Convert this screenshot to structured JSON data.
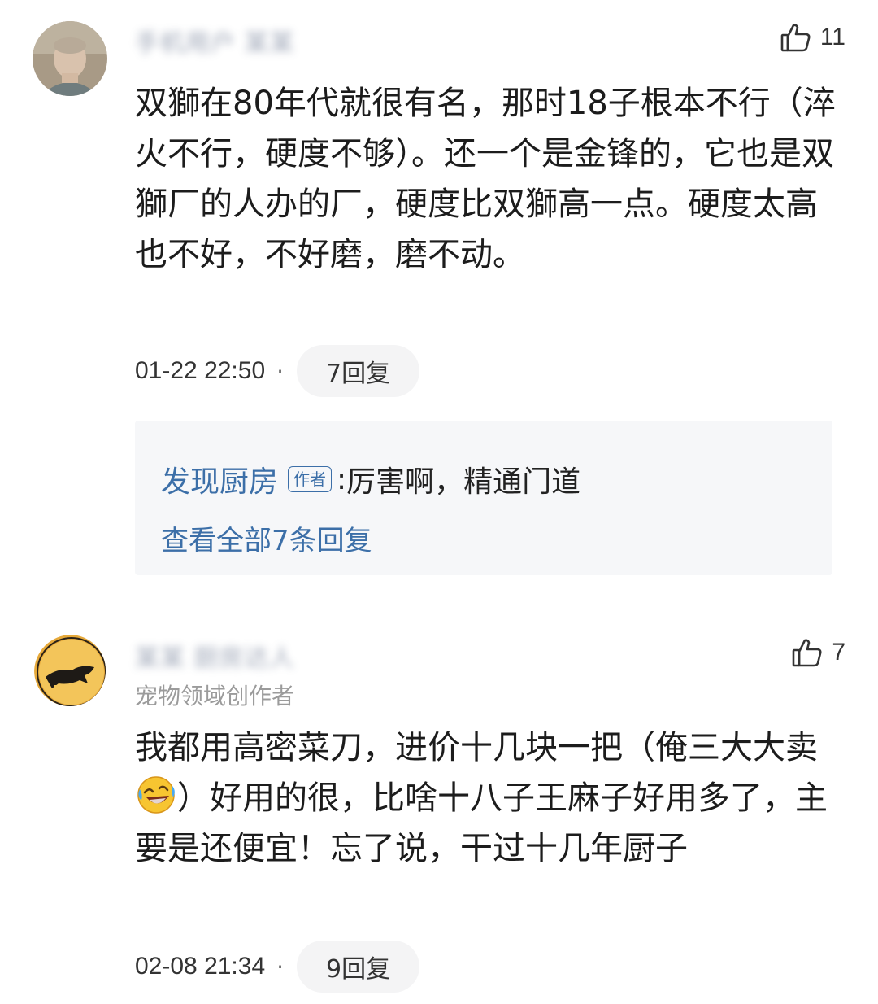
{
  "comments": [
    {
      "username": "手机用户 某某",
      "likes": "11",
      "body": "双獅在80年代就很有名，那时18子根本不行（淬火不行，硬度不够）。还一个是金锋的，它也是双獅厂的人办的厂，硬度比双獅高一点。硬度太高也不好，不好磨，磨不动。",
      "time": "01-22 22:50",
      "replies_label": "7回复",
      "reply_preview": {
        "author": "发现厨房",
        "badge": "作者",
        "separator": ": ",
        "text": "厉害啊，精通门道",
        "view_all": "查看全部7条回复"
      }
    },
    {
      "username": "某某 厨房达人",
      "likes": "7",
      "subtitle": "宠物领域创作者",
      "body_before_emoji": "我都用高密菜刀，进价十几块一把（俺三大大卖",
      "emoji_icon": "rolling-laughing-emoji",
      "body_after_emoji": "）好用的很，比啥十八子王麻子好用多了，主要是还便宜！忘了说，干过十几年厨子",
      "time": "02-08 21:34",
      "replies_label": "9回复"
    }
  ],
  "separator_dot": "·",
  "icons": {
    "like": "thumbs-up-icon"
  }
}
